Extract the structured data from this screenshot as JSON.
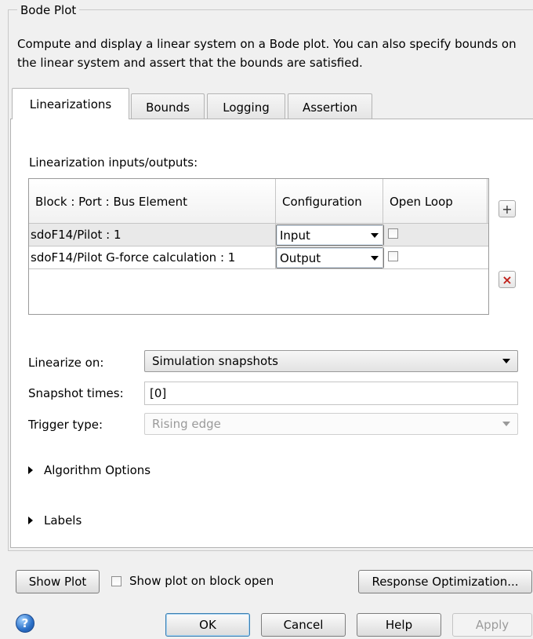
{
  "group": {
    "title": "Bode Plot",
    "description": "Compute and display a linear system on a Bode plot. You can also specify bounds on the linear system and assert that the bounds are satisfied."
  },
  "tabs": [
    {
      "label": "Linearizations",
      "active": true
    },
    {
      "label": "Bounds",
      "active": false
    },
    {
      "label": "Logging",
      "active": false
    },
    {
      "label": "Assertion",
      "active": false
    }
  ],
  "linearizations": {
    "io_label": "Linearization inputs/outputs:",
    "columns": [
      "Block : Port : Bus Element",
      "Configuration",
      "Open Loop"
    ],
    "rows": [
      {
        "block": "sdoF14/Pilot : 1",
        "configuration": "Input",
        "open_loop": false
      },
      {
        "block": "sdoF14/Pilot G-force calculation : 1",
        "configuration": "Output",
        "open_loop": false
      }
    ],
    "add_glyph": "+",
    "remove_glyph": "×",
    "linearize_on_label": "Linearize on:",
    "linearize_on_value": "Simulation snapshots",
    "snapshot_label": "Snapshot times:",
    "snapshot_value": "[0]",
    "trigger_label": "Trigger type:",
    "trigger_value": "Rising edge",
    "algorithm_options": "Algorithm Options",
    "labels_section": "Labels"
  },
  "footer": {
    "show_plot": "Show Plot",
    "show_on_open": "Show plot on block open",
    "response_optimization": "Response Optimization...",
    "help_glyph": "?",
    "ok": "OK",
    "cancel": "Cancel",
    "help": "Help",
    "apply": "Apply"
  }
}
